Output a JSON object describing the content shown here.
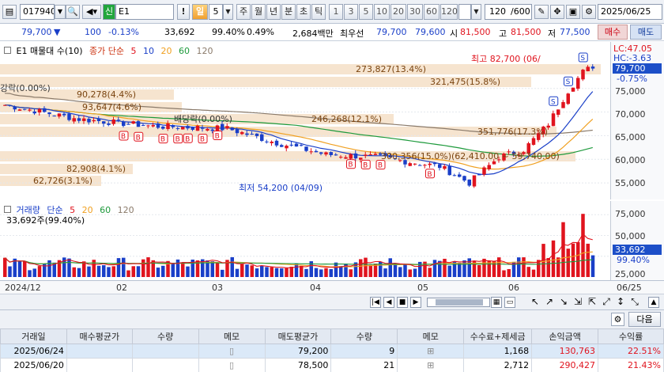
{
  "toolbar": {
    "code": "017940",
    "market_badge": "신",
    "name": "E1",
    "period_selected": "일",
    "period_num": "5",
    "periods": [
      "주",
      "월",
      "년",
      "분",
      "초",
      "틱"
    ],
    "counts": [
      "1",
      "3",
      "5",
      "10",
      "20",
      "30",
      "60",
      "120"
    ],
    "view_count": "120",
    "view_total": "/600",
    "date": "2025/06/25"
  },
  "quote": {
    "price": "79,700",
    "change_arrow": "▼",
    "change": "100",
    "change_pct": "-0.13%",
    "volume": "33,692",
    "vol_ratio": "99.40%",
    "turnover": "0.49%",
    "amount": "2,684백만",
    "best_label": "최우선",
    "best_ask": "79,700",
    "best_bid": "79,600",
    "open_label": "시",
    "open": "81,500",
    "high_label": "고",
    "high": "81,500",
    "low_label": "저",
    "low": "77,500",
    "buy_label": "매수",
    "sell_label": "매도"
  },
  "price_chart": {
    "legend_title": "E1 매물대 수(10)",
    "legend_ma_label": "종가 단순",
    "ma_periods": [
      "5",
      "10",
      "20",
      "60",
      "120"
    ],
    "ma_colors": [
      "#e0141e",
      "#1a3fc8",
      "#f0a020",
      "#1e9a3c",
      "#8a7a6a"
    ],
    "lc": "LC:47.05",
    "hc": "HC:-3.63",
    "last_price": "79,700",
    "last_pct": "-0.75%",
    "y_ticks": [
      "75,000",
      "70,000",
      "65,000",
      "60,000",
      "55,000"
    ],
    "high_note": "최고 82,700 (06/",
    "low_note": "최저 54,200 (04/09)",
    "split_note_left": "강락(0.00%)",
    "split_note_mid": "배당락(0.00%)",
    "volume_bands": [
      {
        "label": "273,827(13.4%)"
      },
      {
        "label": "321,475(15.8%)"
      },
      {
        "label": "90,278(4.4%)"
      },
      {
        "label": "93,647(4.6%)"
      },
      {
        "label": "246,268(12.1%)"
      },
      {
        "label": "351,776(17.3%)"
      },
      {
        "label": "300,356(15.0%)(62,410.00 ~ 59,740.00)"
      },
      {
        "label": "82,908(4.1%)"
      },
      {
        "label": "62,726(3.1%)"
      }
    ],
    "signal_b": "B",
    "signal_s": "S"
  },
  "volume_chart": {
    "legend_title": "거래량",
    "legend_ma_label": "단순",
    "ma_periods": [
      "5",
      "20",
      "60",
      "120"
    ],
    "ma_colors": [
      "#e0141e",
      "#f0a020",
      "#1e9a3c",
      "#8a7a6a"
    ],
    "current": "33,692주(99.40%)",
    "y_ticks": [
      "75,000",
      "50,000",
      "25,000"
    ],
    "last_volume": "33,692",
    "last_pct": "99.40%"
  },
  "time_axis": {
    "labels": [
      "2024/12",
      "02",
      "03",
      "04",
      "05",
      "06"
    ],
    "right_date": "06/25"
  },
  "trades": {
    "next_label": "다음",
    "columns": [
      "거래일",
      "매수평균가",
      "수량",
      "메모",
      "매도평균가",
      "수량",
      "메모",
      "수수료+제세금",
      "손익금액",
      "수익률"
    ],
    "rows": [
      {
        "date": "2025/06/24",
        "buy_avg": "",
        "buy_qty": "",
        "sell_avg": "79,200",
        "sell_qty": "9",
        "fee": "1,168",
        "pnl": "130,763",
        "ret": "22.51%"
      },
      {
        "date": "2025/06/20",
        "buy_avg": "",
        "buy_qty": "",
        "sell_avg": "78,500",
        "sell_qty": "21",
        "fee": "2,712",
        "pnl": "290,427",
        "ret": "21.43%"
      }
    ]
  }
}
